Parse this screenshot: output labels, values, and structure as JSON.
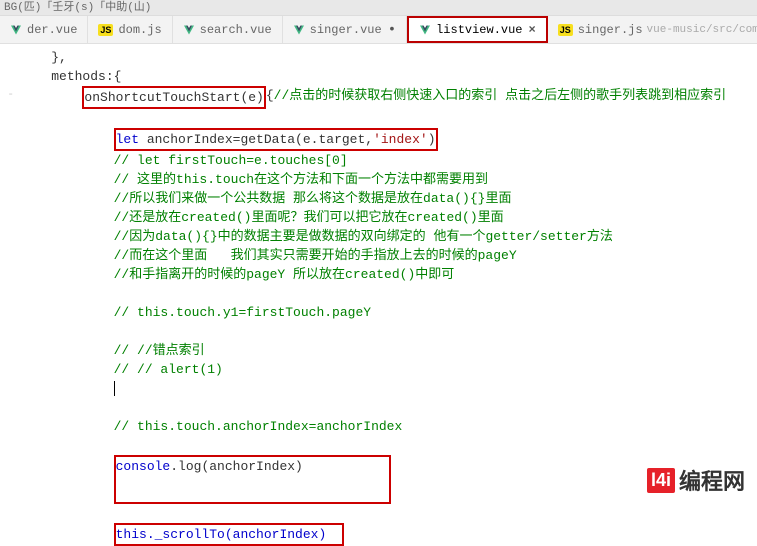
{
  "toolbar_fragment": "BG(匹)「壬牙(s)「中助(山)",
  "tabs": [
    {
      "type": "vue",
      "label": "der.vue",
      "close": false
    },
    {
      "type": "js",
      "label": "dom.js",
      "close": false
    },
    {
      "type": "vue",
      "label": "search.vue",
      "close": false
    },
    {
      "type": "vue",
      "label": "singer.vue",
      "close": false
    },
    {
      "type": "vue",
      "label": "listview.vue",
      "close": true,
      "active": true
    },
    {
      "type": "js",
      "label": "singer.js",
      "dim": "vue-music/src/common/j",
      "close": false
    }
  ],
  "code": {
    "l1": "},",
    "l2": "methods:{",
    "fn_name": "onShortcutTouchStart(e)",
    "fn_after_open": "{",
    "fn_comment": "//点击的时候获取右侧快速入口的索引 点击之后左侧的歌手列表跳到相应索引",
    "let_kw": "let",
    "let_line": " anchorIndex=getData(e.target,",
    "let_str": "'index'",
    "let_end": ")",
    "c1": "// let firstTouch=e.touches[0]",
    "c2": "// 这里的this.touch在这个方法和下面一个方法中都需要用到",
    "c3": "//所以我们来做一个公共数据 那么将这个数据是放在data(){}里面",
    "c4": "//还是放在created()里面呢？我们可以把它放在created()里面",
    "c5": "//因为data(){}中的数据主要是做数据的双向绑定的 他有一个getter/setter方法",
    "c6": "//而在这个里面   我们其实只需要开始的手指放上去的时候的pageY",
    "c7": "//和手指离开的时候的pageY 所以放在created()中即可",
    "c8": "// this.touch.y1=firstTouch.pageY",
    "c9": "// //错点索引",
    "c10": "// // alert(1)",
    "c11": "// this.touch.anchorIndex=anchorIndex",
    "console_fn": "console",
    "console_rest": ".log(anchorIndex)",
    "scroll_line": "this._scrollTo(anchorIndex)"
  },
  "watermark": {
    "logo": "l4i",
    "text": "编程网"
  }
}
